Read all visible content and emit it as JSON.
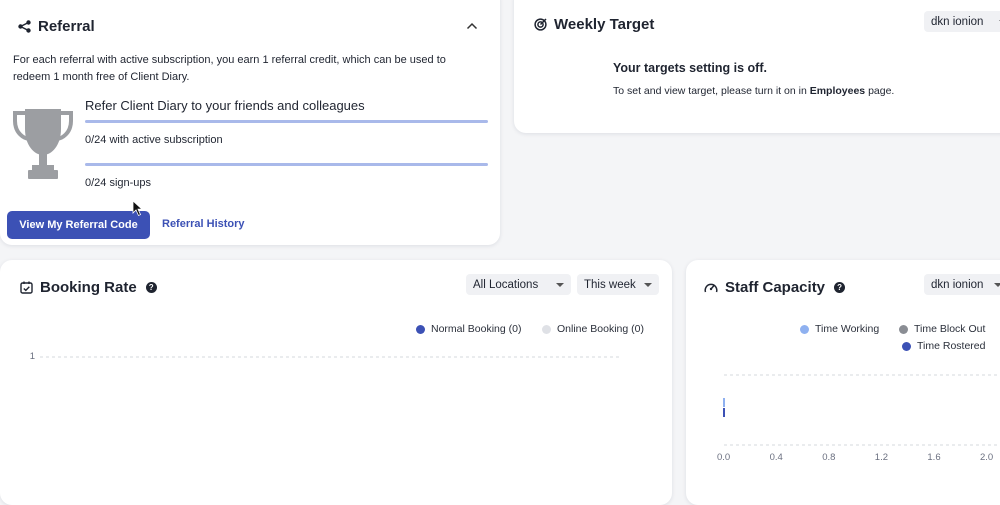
{
  "referral": {
    "title": "Referral",
    "description": "For each referral with active subscription, you earn 1 referral credit, which can be used to redeem 1 month free of Client Diary.",
    "heading": "Refer Client Diary to your friends and colleagues",
    "active_label": "0/24 with active subscription",
    "active_progress": 0,
    "signups_label": "0/24 sign-ups",
    "signups_progress": 0,
    "view_code_button": "View My Referral Code",
    "history_link": "Referral History"
  },
  "weekly_target": {
    "title": "Weekly Target",
    "staff_select": "dkn ionion",
    "message_title": "Your targets setting is off.",
    "message_prefix": "To set and view target, please turn it on in ",
    "message_link": "Employees",
    "message_suffix": " page."
  },
  "booking_rate": {
    "title": "Booking Rate",
    "location_select": "All Locations",
    "period_select": "This week",
    "chart_data": {
      "type": "line",
      "series": [
        {
          "name": "Normal Booking (0)",
          "color": "#3c51b5",
          "values": []
        },
        {
          "name": "Online Booking (0)",
          "color": "#dfe1e6",
          "values": []
        }
      ],
      "y_ticks": [
        "1"
      ],
      "grid": true
    }
  },
  "staff_capacity": {
    "title": "Staff Capacity",
    "staff_select": "dkn ionion",
    "chart_data": {
      "type": "bar",
      "series": [
        {
          "name": "Time Working",
          "color": "#8fb1f0"
        },
        {
          "name": "Time Block Out",
          "color": "#8a8d94"
        },
        {
          "name": "Time Rostered",
          "color": "#3c51b5"
        }
      ],
      "x_ticks": [
        "0.0",
        "0.4",
        "0.8",
        "1.2",
        "1.6",
        "2.0"
      ],
      "xlim": [
        0,
        2
      ],
      "grid": true
    }
  }
}
